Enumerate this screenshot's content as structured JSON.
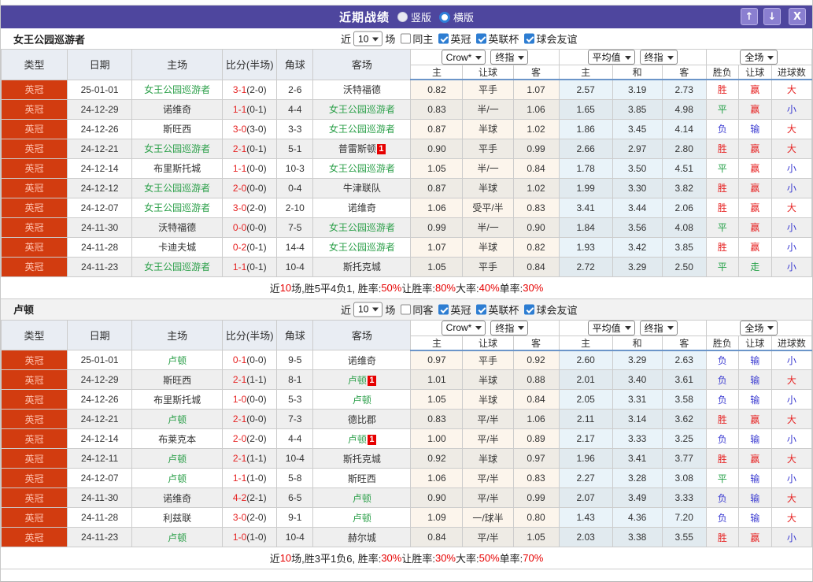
{
  "titlebar": {
    "title": "近期战绩",
    "vertical_label": "竖版",
    "horizontal_label": "横版",
    "up_icon": "↑",
    "down_icon": "↓",
    "close_icon": "X"
  },
  "table_header": {
    "cols": [
      "类型",
      "日期",
      "主场",
      "比分(半场)",
      "角球",
      "客场"
    ],
    "dd_crow": "Crow*",
    "dd_final1": "终指",
    "dd_avg": "平均值",
    "dd_final2": "终指",
    "dd_fulltime": "全场",
    "sub": [
      "主",
      "让球",
      "客",
      "主",
      "和",
      "客",
      "胜负",
      "让球",
      "进球数"
    ]
  },
  "colors": {
    "accent_red": "#e62222",
    "accent_green": "#23a046",
    "accent_blue": "#3a3ad1",
    "team_highlight": "#2ca04a",
    "league_badge_bg": "#d23c10",
    "titlebar_purple": "#4e469e"
  },
  "result_colors": {
    "胜": "#e62222",
    "平": "#23a046",
    "负": "#3a3ad1",
    "赢": "#e62222",
    "输": "#3a3ad1",
    "走": "#23a046",
    "大": "#e62222",
    "小": "#3a3ad1"
  },
  "filter_labels": {
    "near": "近",
    "games": "场"
  },
  "sections": [
    {
      "team": "女王公园巡游者",
      "filter": {
        "count": "10",
        "same_label": "同主",
        "leagues": [
          "英冠",
          "英联杯",
          "球会友谊"
        ]
      },
      "rows": [
        {
          "lg": "英冠",
          "dt": "25-01-01",
          "h": "女王公园巡游者",
          "hh": true,
          "hc": false,
          "ft": "3-1",
          "ht": "(2-0)",
          "cn": "2-6",
          "a": "沃特福德",
          "ah": false,
          "ac": false,
          "o": [
            "0.82",
            "平手",
            "1.07"
          ],
          "v": [
            "2.57",
            "3.19",
            "2.73"
          ],
          "r": [
            "胜",
            "赢",
            "大"
          ]
        },
        {
          "lg": "英冠",
          "dt": "24-12-29",
          "h": "诺维奇",
          "hh": false,
          "hc": false,
          "ft": "1-1",
          "ht": "(0-1)",
          "cn": "4-4",
          "a": "女王公园巡游者",
          "ah": true,
          "ac": false,
          "o": [
            "0.83",
            "半/一",
            "1.06"
          ],
          "v": [
            "1.65",
            "3.85",
            "4.98"
          ],
          "r": [
            "平",
            "赢",
            "小"
          ]
        },
        {
          "lg": "英冠",
          "dt": "24-12-26",
          "h": "斯旺西",
          "hh": false,
          "hc": false,
          "ft": "3-0",
          "ht": "(3-0)",
          "cn": "3-3",
          "a": "女王公园巡游者",
          "ah": true,
          "ac": false,
          "o": [
            "0.87",
            "半球",
            "1.02"
          ],
          "v": [
            "1.86",
            "3.45",
            "4.14"
          ],
          "r": [
            "负",
            "输",
            "大"
          ]
        },
        {
          "lg": "英冠",
          "dt": "24-12-21",
          "h": "女王公园巡游者",
          "hh": true,
          "hc": false,
          "ft": "2-1",
          "ht": "(0-1)",
          "cn": "5-1",
          "a": "普雷斯顿",
          "ah": false,
          "ac": true,
          "o": [
            "0.90",
            "平手",
            "0.99"
          ],
          "v": [
            "2.66",
            "2.97",
            "2.80"
          ],
          "r": [
            "胜",
            "赢",
            "大"
          ]
        },
        {
          "lg": "英冠",
          "dt": "24-12-14",
          "h": "布里斯托城",
          "hh": false,
          "hc": false,
          "ft": "1-1",
          "ht": "(0-0)",
          "cn": "10-3",
          "a": "女王公园巡游者",
          "ah": true,
          "ac": false,
          "o": [
            "1.05",
            "半/一",
            "0.84"
          ],
          "v": [
            "1.78",
            "3.50",
            "4.51"
          ],
          "r": [
            "平",
            "赢",
            "小"
          ]
        },
        {
          "lg": "英冠",
          "dt": "24-12-12",
          "h": "女王公园巡游者",
          "hh": true,
          "hc": false,
          "ft": "2-0",
          "ht": "(0-0)",
          "cn": "0-4",
          "a": "牛津联队",
          "ah": false,
          "ac": false,
          "o": [
            "0.87",
            "半球",
            "1.02"
          ],
          "v": [
            "1.99",
            "3.30",
            "3.82"
          ],
          "r": [
            "胜",
            "赢",
            "小"
          ]
        },
        {
          "lg": "英冠",
          "dt": "24-12-07",
          "h": "女王公园巡游者",
          "hh": true,
          "hc": false,
          "ft": "3-0",
          "ht": "(2-0)",
          "cn": "2-10",
          "a": "诺维奇",
          "ah": false,
          "ac": false,
          "o": [
            "1.06",
            "受平/半",
            "0.83"
          ],
          "v": [
            "3.41",
            "3.44",
            "2.06"
          ],
          "r": [
            "胜",
            "赢",
            "大"
          ]
        },
        {
          "lg": "英冠",
          "dt": "24-11-30",
          "h": "沃特福德",
          "hh": false,
          "hc": false,
          "ft": "0-0",
          "ht": "(0-0)",
          "cn": "7-5",
          "a": "女王公园巡游者",
          "ah": true,
          "ac": false,
          "o": [
            "0.99",
            "半/一",
            "0.90"
          ],
          "v": [
            "1.84",
            "3.56",
            "4.08"
          ],
          "r": [
            "平",
            "赢",
            "小"
          ]
        },
        {
          "lg": "英冠",
          "dt": "24-11-28",
          "h": "卡迪夫城",
          "hh": false,
          "hc": false,
          "ft": "0-2",
          "ht": "(0-1)",
          "cn": "14-4",
          "a": "女王公园巡游者",
          "ah": true,
          "ac": false,
          "o": [
            "1.07",
            "半球",
            "0.82"
          ],
          "v": [
            "1.93",
            "3.42",
            "3.85"
          ],
          "r": [
            "胜",
            "赢",
            "小"
          ]
        },
        {
          "lg": "英冠",
          "dt": "24-11-23",
          "h": "女王公园巡游者",
          "hh": true,
          "hc": false,
          "ft": "1-1",
          "ht": "(0-1)",
          "cn": "10-4",
          "a": "斯托克城",
          "ah": false,
          "ac": false,
          "o": [
            "1.05",
            "平手",
            "0.84"
          ],
          "v": [
            "2.72",
            "3.29",
            "2.50"
          ],
          "r": [
            "平",
            "走",
            "小"
          ]
        }
      ],
      "summary": [
        "近",
        "10",
        "场,胜5平4负1, 胜率:",
        "50%",
        " 让胜率:",
        "80%",
        " 大率:",
        "40%",
        " 单率:",
        "30%"
      ]
    },
    {
      "team": "卢顿",
      "filter": {
        "count": "10",
        "same_label": "同客",
        "leagues": [
          "英冠",
          "英联杯",
          "球会友谊"
        ]
      },
      "rows": [
        {
          "lg": "英冠",
          "dt": "25-01-01",
          "h": "卢顿",
          "hh": true,
          "hc": false,
          "ft": "0-1",
          "ht": "(0-0)",
          "cn": "9-5",
          "a": "诺维奇",
          "ah": false,
          "ac": false,
          "o": [
            "0.97",
            "平手",
            "0.92"
          ],
          "v": [
            "2.60",
            "3.29",
            "2.63"
          ],
          "r": [
            "负",
            "输",
            "小"
          ]
        },
        {
          "lg": "英冠",
          "dt": "24-12-29",
          "h": "斯旺西",
          "hh": false,
          "hc": false,
          "ft": "2-1",
          "ht": "(1-1)",
          "cn": "8-1",
          "a": "卢顿",
          "ah": true,
          "ac": true,
          "o": [
            "1.01",
            "半球",
            "0.88"
          ],
          "v": [
            "2.01",
            "3.40",
            "3.61"
          ],
          "r": [
            "负",
            "输",
            "大"
          ]
        },
        {
          "lg": "英冠",
          "dt": "24-12-26",
          "h": "布里斯托城",
          "hh": false,
          "hc": false,
          "ft": "1-0",
          "ht": "(0-0)",
          "cn": "5-3",
          "a": "卢顿",
          "ah": true,
          "ac": false,
          "o": [
            "1.05",
            "半球",
            "0.84"
          ],
          "v": [
            "2.05",
            "3.31",
            "3.58"
          ],
          "r": [
            "负",
            "输",
            "小"
          ]
        },
        {
          "lg": "英冠",
          "dt": "24-12-21",
          "h": "卢顿",
          "hh": true,
          "hc": false,
          "ft": "2-1",
          "ht": "(0-0)",
          "cn": "7-3",
          "a": "德比郡",
          "ah": false,
          "ac": false,
          "o": [
            "0.83",
            "平/半",
            "1.06"
          ],
          "v": [
            "2.11",
            "3.14",
            "3.62"
          ],
          "r": [
            "胜",
            "赢",
            "大"
          ]
        },
        {
          "lg": "英冠",
          "dt": "24-12-14",
          "h": "布莱克本",
          "hh": false,
          "hc": false,
          "ft": "2-0",
          "ht": "(2-0)",
          "cn": "4-4",
          "a": "卢顿",
          "ah": true,
          "ac": true,
          "o": [
            "1.00",
            "平/半",
            "0.89"
          ],
          "v": [
            "2.17",
            "3.33",
            "3.25"
          ],
          "r": [
            "负",
            "输",
            "小"
          ]
        },
        {
          "lg": "英冠",
          "dt": "24-12-11",
          "h": "卢顿",
          "hh": true,
          "hc": false,
          "ft": "2-1",
          "ht": "(1-1)",
          "cn": "10-4",
          "a": "斯托克城",
          "ah": false,
          "ac": false,
          "o": [
            "0.92",
            "半球",
            "0.97"
          ],
          "v": [
            "1.96",
            "3.41",
            "3.77"
          ],
          "r": [
            "胜",
            "赢",
            "大"
          ]
        },
        {
          "lg": "英冠",
          "dt": "24-12-07",
          "h": "卢顿",
          "hh": true,
          "hc": false,
          "ft": "1-1",
          "ht": "(1-0)",
          "cn": "5-8",
          "a": "斯旺西",
          "ah": false,
          "ac": false,
          "o": [
            "1.06",
            "平/半",
            "0.83"
          ],
          "v": [
            "2.27",
            "3.28",
            "3.08"
          ],
          "r": [
            "平",
            "输",
            "小"
          ]
        },
        {
          "lg": "英冠",
          "dt": "24-11-30",
          "h": "诺维奇",
          "hh": false,
          "hc": false,
          "ft": "4-2",
          "ht": "(2-1)",
          "cn": "6-5",
          "a": "卢顿",
          "ah": true,
          "ac": false,
          "o": [
            "0.90",
            "平/半",
            "0.99"
          ],
          "v": [
            "2.07",
            "3.49",
            "3.33"
          ],
          "r": [
            "负",
            "输",
            "大"
          ]
        },
        {
          "lg": "英冠",
          "dt": "24-11-28",
          "h": "利兹联",
          "hh": false,
          "hc": false,
          "ft": "3-0",
          "ht": "(2-0)",
          "cn": "9-1",
          "a": "卢顿",
          "ah": true,
          "ac": false,
          "o": [
            "1.09",
            "一/球半",
            "0.80"
          ],
          "v": [
            "1.43",
            "4.36",
            "7.20"
          ],
          "r": [
            "负",
            "输",
            "大"
          ]
        },
        {
          "lg": "英冠",
          "dt": "24-11-23",
          "h": "卢顿",
          "hh": true,
          "hc": false,
          "ft": "1-0",
          "ht": "(1-0)",
          "cn": "10-4",
          "a": "赫尔城",
          "ah": false,
          "ac": false,
          "o": [
            "0.84",
            "平/半",
            "1.05"
          ],
          "v": [
            "2.03",
            "3.38",
            "3.55"
          ],
          "r": [
            "胜",
            "赢",
            "小"
          ]
        }
      ],
      "summary": [
        "近",
        "10",
        "场,胜3平1负6, 胜率:",
        "30%",
        " 让胜率:",
        "30%",
        " 大率:",
        "50%",
        " 单率:",
        "70%"
      ]
    }
  ]
}
